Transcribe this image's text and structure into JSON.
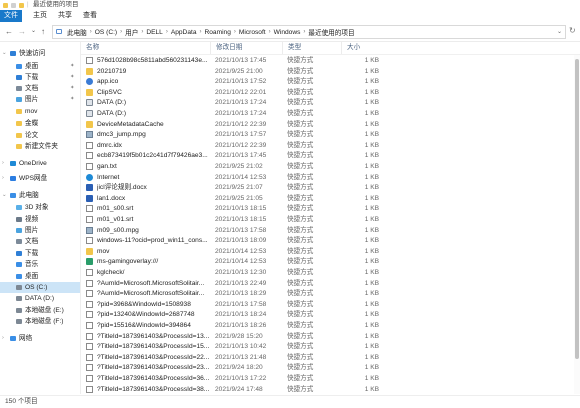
{
  "window": {
    "title": "最近使用的项目"
  },
  "ribbon": {
    "tabs": [
      "文件",
      "主页",
      "共享",
      "查看"
    ]
  },
  "nav": {
    "back": "←",
    "forward": "→",
    "recent": "⌄",
    "up": "↑",
    "refresh": "↻",
    "dropdown": "⌄",
    "breadcrumbs": [
      "此电脑",
      "OS (C:)",
      "用户",
      "DELL",
      "AppData",
      "Roaming",
      "Microsoft",
      "Windows",
      "最近使用的项目"
    ]
  },
  "sidebar": {
    "items": [
      {
        "label": "快速访问",
        "icon": "star-icon",
        "color": "#2f7fd6",
        "level": 0,
        "expander": "⌄",
        "pinned": false
      },
      {
        "label": "桌面",
        "icon": "desktop-icon",
        "color": "#3a8ee6",
        "level": 1,
        "pinned": true
      },
      {
        "label": "下载",
        "icon": "download-icon",
        "color": "#2f7fd6",
        "level": 1,
        "pinned": true
      },
      {
        "label": "文档",
        "icon": "document-icon",
        "color": "#7c8a99",
        "level": 1,
        "pinned": true
      },
      {
        "label": "图片",
        "icon": "picture-icon",
        "color": "#4aa3df",
        "level": 1,
        "pinned": true
      },
      {
        "label": "mov",
        "icon": "folder-icon",
        "color": "#f2c64b",
        "level": 1,
        "pinned": false
      },
      {
        "label": "金蝶",
        "icon": "folder-icon",
        "color": "#f2c64b",
        "level": 1,
        "pinned": false
      },
      {
        "label": "论文",
        "icon": "folder-icon",
        "color": "#f2c64b",
        "level": 1,
        "pinned": false
      },
      {
        "label": "新建文件夹",
        "icon": "folder-icon",
        "color": "#f2c64b",
        "level": 1,
        "pinned": false
      },
      {
        "label": "OneDrive",
        "icon": "cloud-icon",
        "color": "#1e8ad6",
        "level": 0,
        "expander": "›",
        "pinned": false
      },
      {
        "label": "WPS网盘",
        "icon": "cloud-drive-icon",
        "color": "#2b7de1",
        "level": 0,
        "expander": "›",
        "pinned": false
      },
      {
        "label": "此电脑",
        "icon": "computer-icon",
        "color": "#3a8ee6",
        "level": 0,
        "expander": "⌄",
        "pinned": false
      },
      {
        "label": "3D 对象",
        "icon": "cube-icon",
        "color": "#5ab0e8",
        "level": 1,
        "pinned": false
      },
      {
        "label": "视频",
        "icon": "video-icon",
        "color": "#6c7a89",
        "level": 1,
        "pinned": false
      },
      {
        "label": "图片",
        "icon": "picture-icon",
        "color": "#4aa3df",
        "level": 1,
        "pinned": false
      },
      {
        "label": "文档",
        "icon": "document-icon",
        "color": "#7c8a99",
        "level": 1,
        "pinned": false
      },
      {
        "label": "下载",
        "icon": "download-icon",
        "color": "#2f7fd6",
        "level": 1,
        "pinned": false
      },
      {
        "label": "音乐",
        "icon": "music-icon",
        "color": "#3a8ee6",
        "level": 1,
        "pinned": false
      },
      {
        "label": "桌面",
        "icon": "desktop-icon",
        "color": "#3a8ee6",
        "level": 1,
        "pinned": false
      },
      {
        "label": "OS (C:)",
        "icon": "drive-icon",
        "color": "#7d8894",
        "level": 1,
        "pinned": false,
        "selected": true
      },
      {
        "label": "DATA (D:)",
        "icon": "drive-icon",
        "color": "#7d8894",
        "level": 1,
        "pinned": false
      },
      {
        "label": "本地磁盘 (E:)",
        "icon": "drive-icon",
        "color": "#7d8894",
        "level": 1,
        "pinned": false
      },
      {
        "label": "本地磁盘 (F:)",
        "icon": "drive-icon",
        "color": "#7d8894",
        "level": 1,
        "pinned": false
      },
      {
        "label": "网络",
        "icon": "network-icon",
        "color": "#3a8ee6",
        "level": 0,
        "expander": "›",
        "pinned": false
      }
    ],
    "pin_glyph": "✦"
  },
  "columns": {
    "name": "名称",
    "date": "修改日期",
    "type": "类型",
    "size": "大小"
  },
  "files": [
    {
      "name": "576d1028b98c5811abd560231143e...",
      "date": "2021/10/13 17:45",
      "type": "快捷方式",
      "size": "1 KB",
      "icon": "t-lnk"
    },
    {
      "name": "20210719",
      "date": "2021/9/25 21:00",
      "type": "快捷方式",
      "size": "1 KB",
      "icon": "t-folder"
    },
    {
      "name": "app.ico",
      "date": "2021/10/13 17:52",
      "type": "快捷方式",
      "size": "1 KB",
      "icon": "t-blue"
    },
    {
      "name": "ClipSVC",
      "date": "2021/10/12 22:01",
      "type": "快捷方式",
      "size": "1 KB",
      "icon": "t-folder"
    },
    {
      "name": "DATA (D:)",
      "date": "2021/10/13 17:24",
      "type": "快捷方式",
      "size": "1 KB",
      "icon": "t-drive"
    },
    {
      "name": "DATA (D:)",
      "date": "2021/10/13 17:24",
      "type": "快捷方式",
      "size": "1 KB",
      "icon": "t-drive"
    },
    {
      "name": "DeviceMetadataCache",
      "date": "2021/10/12 22:39",
      "type": "快捷方式",
      "size": "1 KB",
      "icon": "t-folder"
    },
    {
      "name": "dmc3_jump.mpg",
      "date": "2021/10/13 17:57",
      "type": "快捷方式",
      "size": "1 KB",
      "icon": "t-media"
    },
    {
      "name": "dmrc.idx",
      "date": "2021/10/12 22:39",
      "type": "快捷方式",
      "size": "1 KB",
      "icon": "t-lnk"
    },
    {
      "name": "ecb873419f5b01c2c41d7f79426ae3...",
      "date": "2021/10/13 17:45",
      "type": "快捷方式",
      "size": "1 KB",
      "icon": "t-lnk"
    },
    {
      "name": "gan.txt",
      "date": "2021/9/25 21:02",
      "type": "快捷方式",
      "size": "1 KB",
      "icon": "t-lnk"
    },
    {
      "name": "Internet",
      "date": "2021/10/14 12:53",
      "type": "快捷方式",
      "size": "1 KB",
      "icon": "t-net"
    },
    {
      "name": "jicl评论规则.docx",
      "date": "2021/9/25 21:07",
      "type": "快捷方式",
      "size": "1 KB",
      "icon": "t-doc"
    },
    {
      "name": "lan1.docx",
      "date": "2021/9/25 21:05",
      "type": "快捷方式",
      "size": "1 KB",
      "icon": "t-doc"
    },
    {
      "name": "m01_s00.srt",
      "date": "2021/10/13 18:15",
      "type": "快捷方式",
      "size": "1 KB",
      "icon": "t-lnk"
    },
    {
      "name": "m01_v01.srt",
      "date": "2021/10/13 18:15",
      "type": "快捷方式",
      "size": "1 KB",
      "icon": "t-lnk"
    },
    {
      "name": "m09_s00.mpg",
      "date": "2021/10/13 17:58",
      "type": "快捷方式",
      "size": "1 KB",
      "icon": "t-media"
    },
    {
      "name": "windows-11?ocid=prod_win11_cons...",
      "date": "2021/10/13 18:09",
      "type": "快捷方式",
      "size": "1 KB",
      "icon": "t-lnk"
    },
    {
      "name": "mov",
      "date": "2021/10/14 12:53",
      "type": "快捷方式",
      "size": "1 KB",
      "icon": "t-folder"
    },
    {
      "name": "ms-gamingoverlay:///",
      "date": "2021/10/14 12:53",
      "type": "快捷方式",
      "size": "1 KB",
      "icon": "t-game"
    },
    {
      "name": "kglcheck/",
      "date": "2021/10/13 12:30",
      "type": "快捷方式",
      "size": "1 KB",
      "icon": "t-lnk"
    },
    {
      "name": "?AumId=Microsoft.MicrosoftSolitair...",
      "date": "2021/10/13 22:49",
      "type": "快捷方式",
      "size": "1 KB",
      "icon": "t-lnk"
    },
    {
      "name": "?AumId=Microsoft.MicrosoftSolitair...",
      "date": "2021/10/13 18:29",
      "type": "快捷方式",
      "size": "1 KB",
      "icon": "t-lnk"
    },
    {
      "name": "?pid=3968&WindowId=1508938",
      "date": "2021/10/13 17:58",
      "type": "快捷方式",
      "size": "1 KB",
      "icon": "t-lnk"
    },
    {
      "name": "?pid=13240&WindowId=2687748",
      "date": "2021/10/13 18:24",
      "type": "快捷方式",
      "size": "1 KB",
      "icon": "t-lnk"
    },
    {
      "name": "?pid=15516&WindowId=394864",
      "date": "2021/10/13 18:26",
      "type": "快捷方式",
      "size": "1 KB",
      "icon": "t-lnk"
    },
    {
      "name": "?TitleId=1873961403&ProcessId=13...",
      "date": "2021/9/28 15:20",
      "type": "快捷方式",
      "size": "1 KB",
      "icon": "t-lnk"
    },
    {
      "name": "?TitleId=1873961403&ProcessId=15...",
      "date": "2021/10/13 10:42",
      "type": "快捷方式",
      "size": "1 KB",
      "icon": "t-lnk"
    },
    {
      "name": "?TitleId=1873961403&ProcessId=22...",
      "date": "2021/10/13 21:48",
      "type": "快捷方式",
      "size": "1 KB",
      "icon": "t-lnk"
    },
    {
      "name": "?TitleId=1873961403&ProcessId=23...",
      "date": "2021/9/24 18:20",
      "type": "快捷方式",
      "size": "1 KB",
      "icon": "t-lnk"
    },
    {
      "name": "?TitleId=1873961403&ProcessId=36...",
      "date": "2021/10/13 17:22",
      "type": "快捷方式",
      "size": "1 KB",
      "icon": "t-lnk"
    },
    {
      "name": "?TitleId=1873961403&ProcessId=38...",
      "date": "2021/9/24 17:48",
      "type": "快捷方式",
      "size": "1 KB",
      "icon": "t-lnk"
    }
  ],
  "status": {
    "count": "150 个项目"
  }
}
